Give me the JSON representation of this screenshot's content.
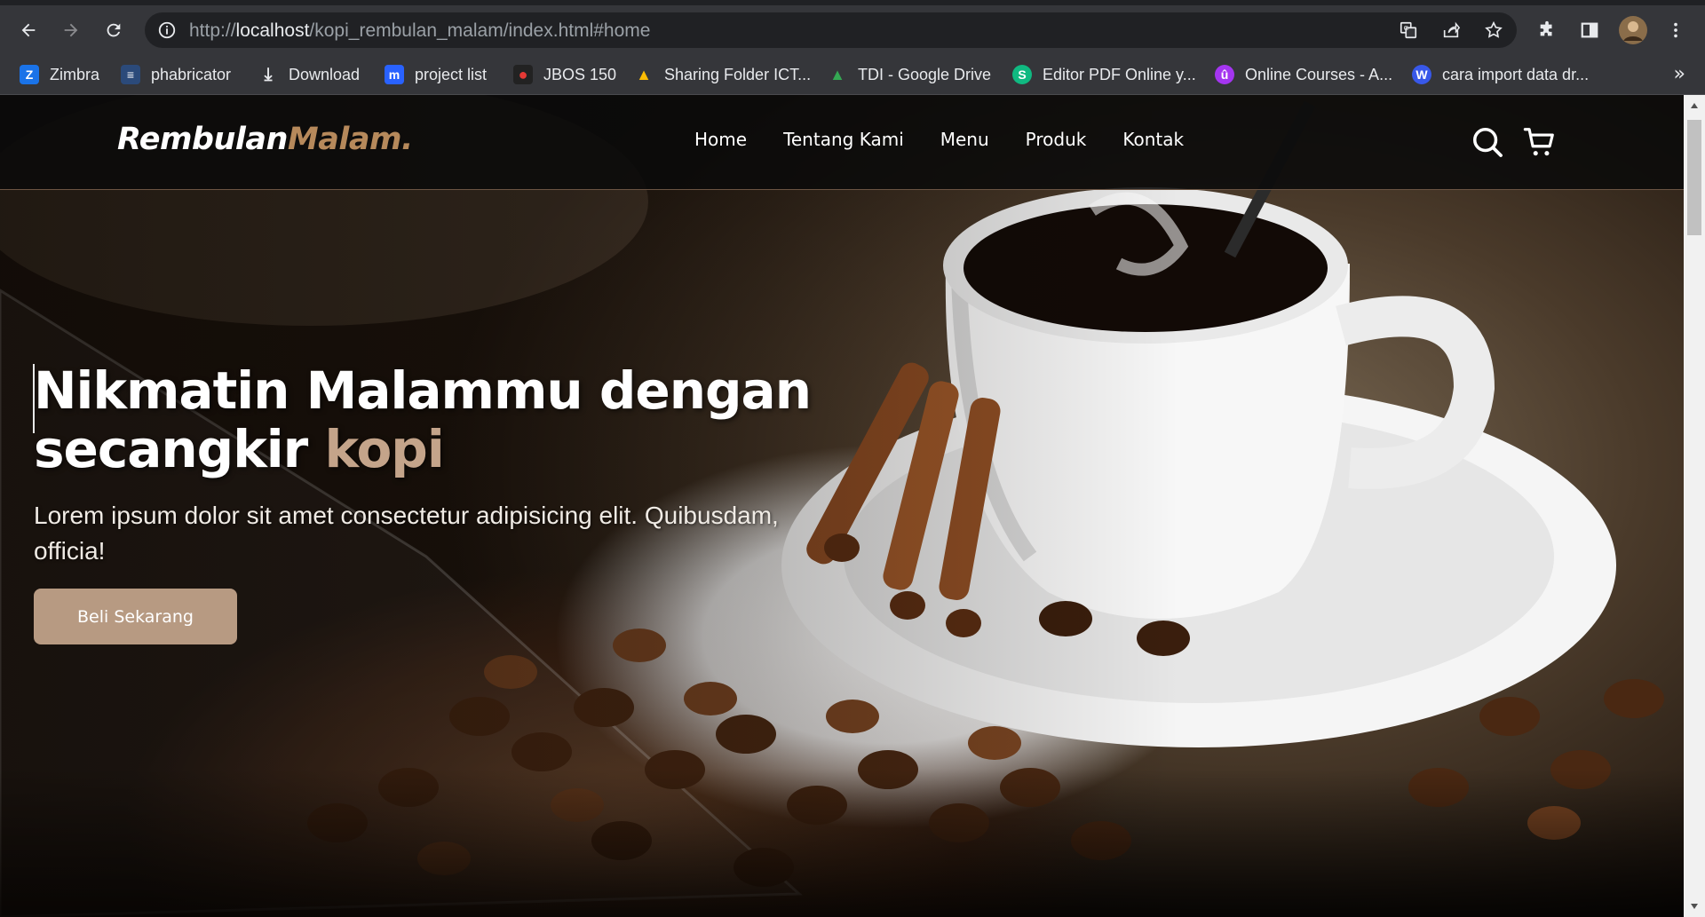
{
  "browser": {
    "url_prefix": "http://",
    "url_host": "localhost",
    "url_path": "/kopi_rembulan_malam/index.html#home",
    "icons": [
      "back-icon",
      "forward-icon",
      "reload-icon",
      "info-icon",
      "translate-icon",
      "share-icon",
      "bookmark-star-icon",
      "extensions-icon",
      "side-panel-icon",
      "profile-avatar",
      "more-menu-icon"
    ]
  },
  "bookmarks": [
    {
      "label": "Zimbra",
      "icon": "Z",
      "color": "#1a73e8"
    },
    {
      "label": "phabricator",
      "icon": "≡",
      "color": "#2b4a7a"
    },
    {
      "label": "Download",
      "icon": "⤓",
      "color": "transparent"
    },
    {
      "label": "project list",
      "icon": "m",
      "color": "#2962ff"
    },
    {
      "label": "JBOS 150",
      "icon": "●",
      "color": "#c62828"
    },
    {
      "label": "Sharing Folder ICT...",
      "icon": "▲",
      "color": "transparent"
    },
    {
      "label": "TDI - Google Drive",
      "icon": "▲",
      "color": "transparent"
    },
    {
      "label": "Editor PDF Online y...",
      "icon": "S",
      "color": "#10b981"
    },
    {
      "label": "Online Courses - A...",
      "icon": "û",
      "color": "#a435f0"
    },
    {
      "label": "cara import data dr...",
      "icon": "W",
      "color": "#3858e9"
    }
  ],
  "bookmarks_more": "»",
  "site": {
    "logo_main": "Rembulan",
    "logo_accent": "Malam.",
    "nav": [
      "Home",
      "Tentang Kami",
      "Menu",
      "Produk",
      "Kontak"
    ],
    "hero_title_line1": "Nikmatin Malammu dengan",
    "hero_title_line2": "secangkir ",
    "hero_title_accent": "kopi",
    "hero_subtitle": "Lorem ipsum dolor sit amet consectetur adipisicing elit. Quibusdam, officia!",
    "cta_label": "Beli Sekarang",
    "colors": {
      "accent": "#b6895b",
      "button": "#b79a82",
      "nav_bg": "#0a0a0a"
    }
  }
}
